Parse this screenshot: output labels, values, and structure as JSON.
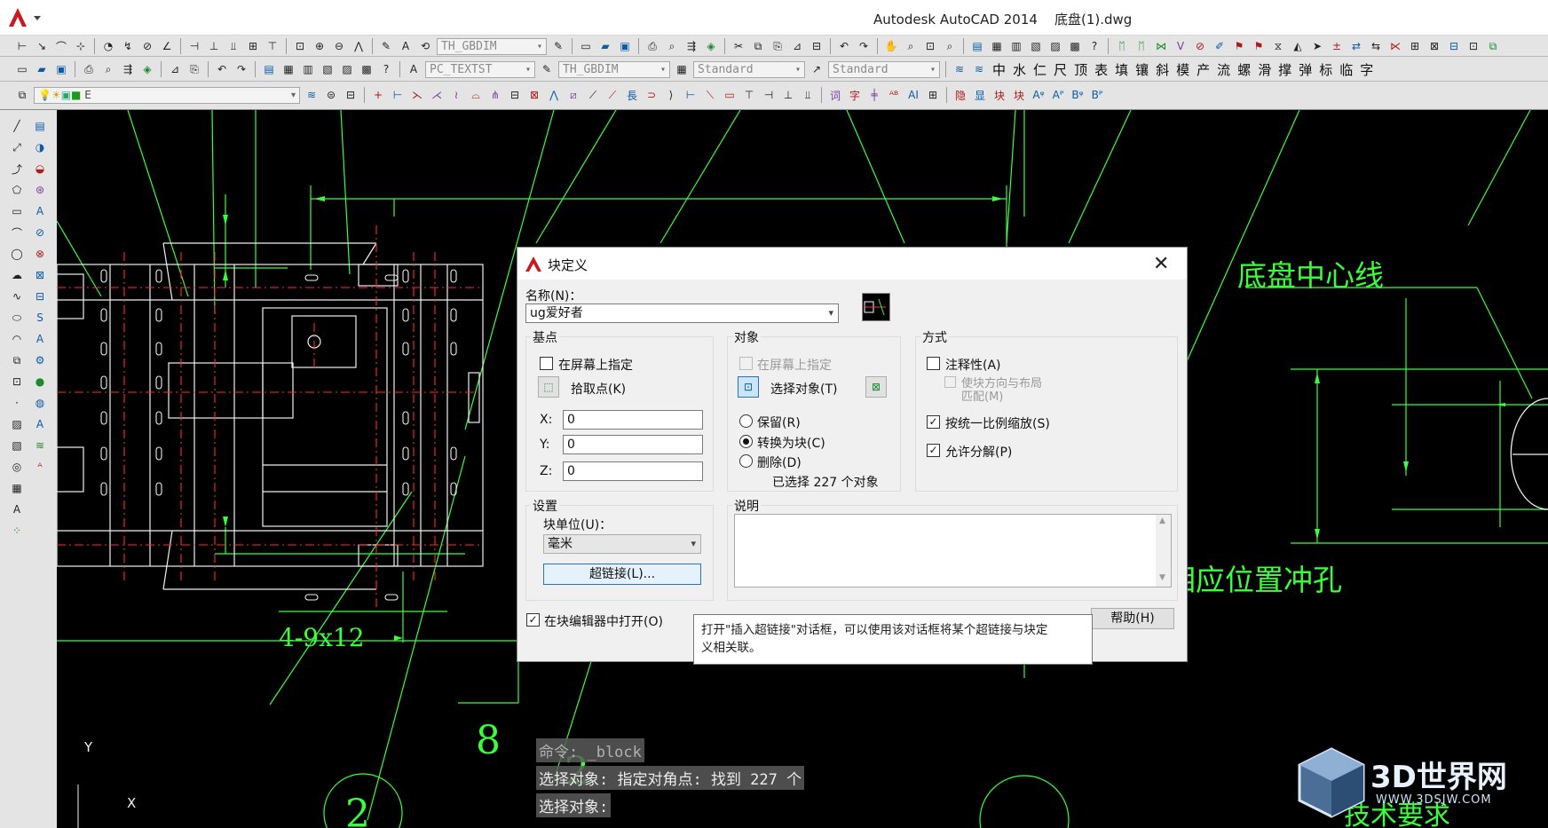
{
  "window": {
    "title": "Autodesk AutoCAD 2014    底盘(1).dwg"
  },
  "toolbar1": {
    "combo_dimstyle": "TH_GBDIM"
  },
  "toolbar2": {
    "combo_textstyle": "PC_TEXTST",
    "combo_dimstyle": "TH_GBDIM",
    "combo_tablestyle": "Standard",
    "combo_mleaderstyle": "Standard",
    "tool_chars": [
      "中",
      "水",
      "仁",
      "尺",
      "顶",
      "表",
      "填",
      "镶",
      "斜",
      "模",
      "产",
      "流",
      "螺",
      "滑",
      "撑",
      "弹",
      "标",
      "临",
      "字"
    ]
  },
  "toolbar3": {
    "layer_current": "E",
    "right_chars": [
      "词",
      "字",
      "AI",
      "隐",
      "显",
      "块",
      "块"
    ]
  },
  "drawing": {
    "labels": {
      "center_line": "底盘中心线",
      "punch": "相应位置冲孔",
      "hole_spec": "4-9x12",
      "num_8": "8",
      "num_2a": "2",
      "num_2b": "2",
      "tech_req": "技术要求"
    },
    "ucs": {
      "x": "X",
      "y": "Y"
    }
  },
  "command_line": {
    "lines": [
      "命令: _block",
      "选择对象: 指定对角点: 找到 227 个",
      "选择对象:"
    ]
  },
  "watermark": {
    "title": "3D世界网",
    "subtitle": "WWW.3DSJW.COM"
  },
  "dialog": {
    "title": "块定义",
    "name_label": "名称(N)：",
    "name_value": "ug爱好者",
    "basepoint": {
      "title": "基点",
      "on_screen": "在屏幕上指定",
      "pick_point": "拾取点(K)",
      "x_label": "X:",
      "x_value": "0",
      "y_label": "Y:",
      "y_value": "0",
      "z_label": "Z:",
      "z_value": "0"
    },
    "objects": {
      "title": "对象",
      "on_screen": "在屏幕上指定",
      "select": "选择对象(T)",
      "retain": "保留(R)",
      "convert": "转换为块(C)",
      "delete": "删除(D)",
      "selected_count": "已选择 227 个对象"
    },
    "behavior": {
      "title": "方式",
      "annotative": "注释性(A)",
      "match_orient": "使块方向与布局",
      "match_orient2": "匹配(M)",
      "scale_uniform": "按统一比例缩放(S)",
      "allow_explode": "允许分解(P)"
    },
    "settings": {
      "title": "设置",
      "unit_label": "块单位(U)：",
      "unit_value": "毫米",
      "hyperlink": "超链接(L)..."
    },
    "description": {
      "title": "说明"
    },
    "open_in_editor": "在块编辑器中打开(O)",
    "help": "帮助(H)"
  },
  "tooltip": {
    "line1": "打开\"插入超链接\"对话框，可以使用该对话框将某个超链接与块定",
    "line2": "义相关联。"
  },
  "colors": {
    "cad_green": "#39ff39",
    "cad_red": "#ff2a2a",
    "cad_white": "#f0f0f0",
    "titlebar": "#ffffff",
    "toolbar": "#e4e4e4"
  }
}
